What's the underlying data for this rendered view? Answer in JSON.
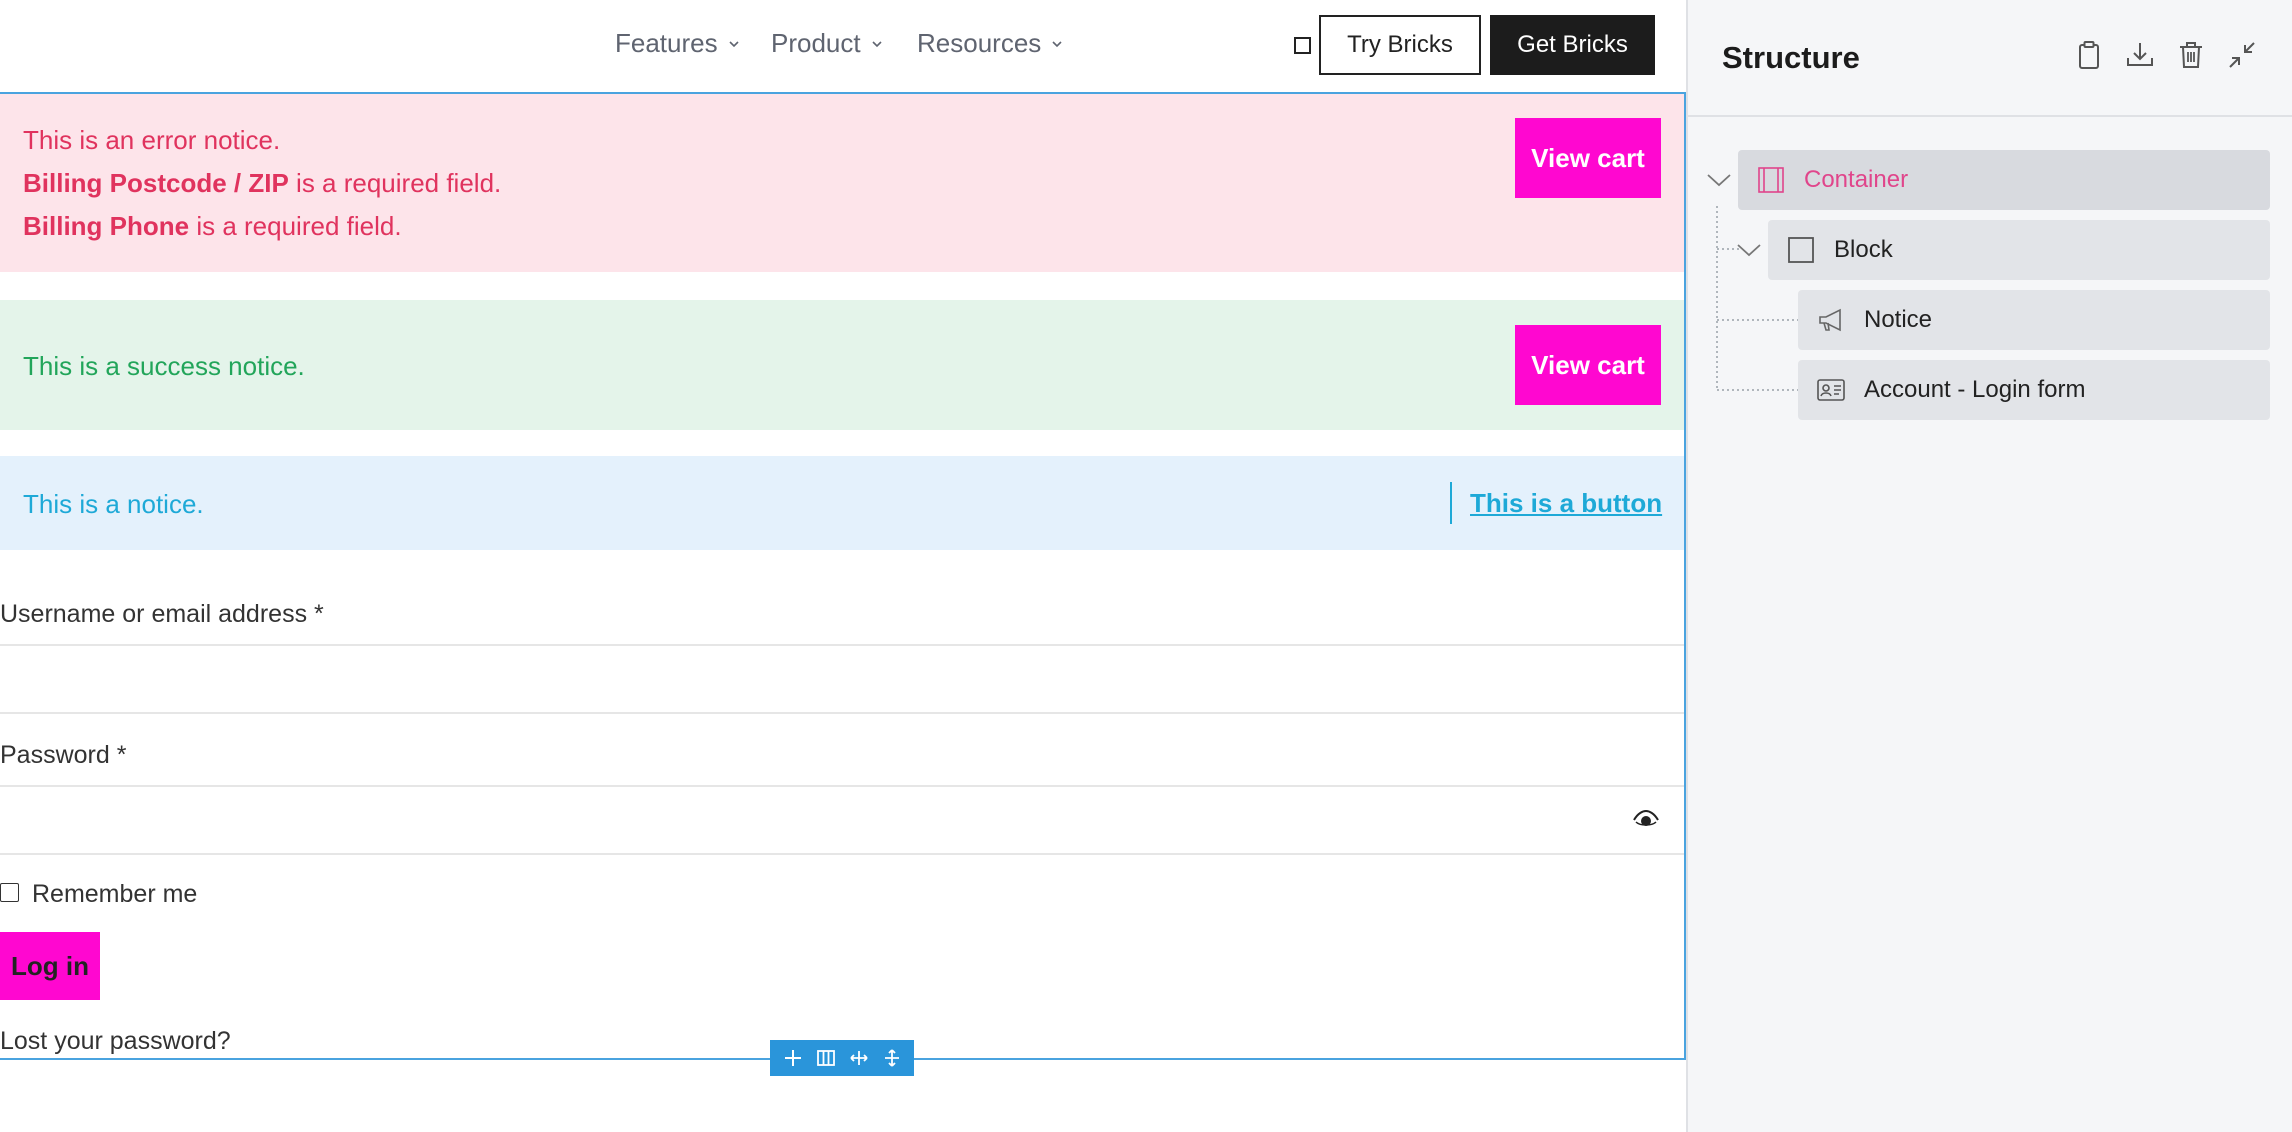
{
  "topnav": {
    "items": [
      {
        "label": "Features"
      },
      {
        "label": "Product"
      },
      {
        "label": "Resources"
      }
    ],
    "try_label": "Try Bricks",
    "get_label": "Get Bricks"
  },
  "notices": {
    "error": {
      "line1": "This is an error notice.",
      "line2_bold": "Billing Postcode / ZIP",
      "line2_rest": " is a required field.",
      "line3_bold": "Billing Phone",
      "line3_rest": " is a required field.",
      "button": "View cart"
    },
    "success": {
      "text": "This is a success notice.",
      "button": "View cart"
    },
    "info": {
      "text": "This is a notice.",
      "button": "This is a button"
    }
  },
  "login_form": {
    "username_label": "Username or email address *",
    "password_label": "Password *",
    "remember_label": "Remember me",
    "remember_checked": false,
    "login_button": "Log in",
    "lost_password": "Lost your password?"
  },
  "toolbar": {
    "icons": [
      "plus-icon",
      "columns-icon",
      "width-icon",
      "height-icon"
    ]
  },
  "structure_panel": {
    "title": "Structure",
    "header_icons": [
      "clipboard-icon",
      "download-icon",
      "trash-icon",
      "collapse-icon"
    ],
    "tree": [
      {
        "label": "Container",
        "icon": "container-icon",
        "active": true
      },
      {
        "label": "Block",
        "icon": "block-icon",
        "active": false
      },
      {
        "label": "Notice",
        "icon": "megaphone-icon",
        "active": false
      },
      {
        "label": "Account - Login form",
        "icon": "id-card-icon",
        "active": false
      }
    ]
  },
  "colors": {
    "accent_magenta": "#ff07d0",
    "error_bg": "#fde4ea",
    "error_text": "#e0335e",
    "success_bg": "#e4f4ea",
    "success_text": "#22a55a",
    "info_bg": "#e4f1fc",
    "info_text": "#1ea9d7",
    "selection_blue": "#2a95da",
    "tree_active_label": "#e0458b"
  }
}
